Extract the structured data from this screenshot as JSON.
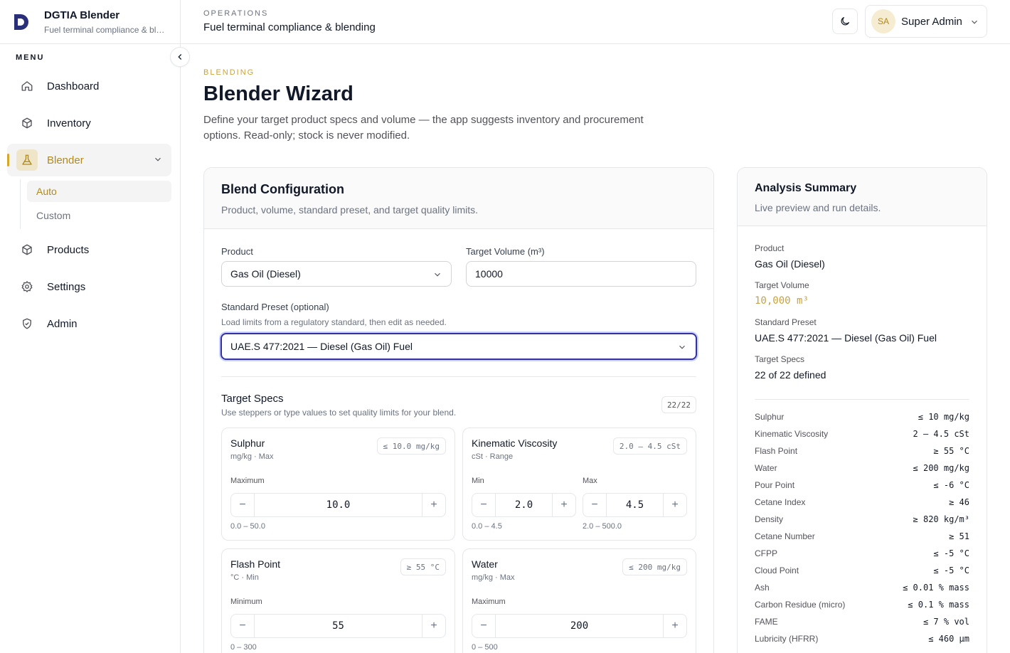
{
  "brand": {
    "title": "DGTIA Blender",
    "subtitle": "Fuel terminal compliance & blending"
  },
  "sidebar": {
    "menu_label": "MENU",
    "items": [
      {
        "label": "Dashboard",
        "icon": "home-icon"
      },
      {
        "label": "Inventory",
        "icon": "box-icon"
      },
      {
        "label": "Blender",
        "icon": "flask-icon",
        "active": true,
        "children": [
          {
            "label": "Auto",
            "active": true
          },
          {
            "label": "Custom"
          }
        ]
      },
      {
        "label": "Products",
        "icon": "box-icon"
      },
      {
        "label": "Settings",
        "icon": "gear-icon"
      },
      {
        "label": "Admin",
        "icon": "shield-icon"
      }
    ]
  },
  "header": {
    "eyebrow": "OPERATIONS",
    "title": "Fuel terminal compliance & blending",
    "user": {
      "initials": "SA",
      "name": "Super Admin"
    }
  },
  "page": {
    "section_label": "BLENDING",
    "title": "Blender Wizard",
    "description": "Define your target product specs and volume — the app suggests inventory and procurement options. Read-only; stock is never modified."
  },
  "config": {
    "title": "Blend Configuration",
    "subtitle": "Product, volume, standard preset, and target quality limits.",
    "product_label": "Product",
    "product_value": "Gas Oil (Diesel)",
    "volume_label": "Target Volume (m³)",
    "volume_value": "10000",
    "preset_label": "Standard Preset (optional)",
    "preset_hint": "Load limits from a regulatory standard, then edit as needed.",
    "preset_value": "UAE.S 477:2021 — Diesel (Gas Oil) Fuel",
    "specs_title": "Target Specs",
    "specs_sub": "Use steppers or type values to set quality limits for your blend.",
    "specs_count": "22/22",
    "specs": [
      {
        "name": "Sulphur",
        "meta": "mg/kg · Max",
        "badge": "≤ 10.0 mg/kg",
        "label": "Maximum",
        "value": "10.0",
        "range": "0.0 – 50.0"
      },
      {
        "name": "Kinematic Viscosity",
        "meta": "cSt · Range",
        "badge": "2.0 – 4.5 cSt",
        "min_label": "Min",
        "min_value": "2.0",
        "min_range": "0.0 – 4.5",
        "max_label": "Max",
        "max_value": "4.5",
        "max_range": "2.0 – 500.0"
      },
      {
        "name": "Flash Point",
        "meta": "°C · Min",
        "badge": "≥ 55 °C",
        "label": "Minimum",
        "value": "55",
        "range": "0 – 300"
      },
      {
        "name": "Water",
        "meta": "mg/kg · Max",
        "badge": "≤ 200 mg/kg",
        "label": "Maximum",
        "value": "200",
        "range": "0 – 500"
      }
    ]
  },
  "summary": {
    "title": "Analysis Summary",
    "subtitle": "Live preview and run details.",
    "product_label": "Product",
    "product_value": "Gas Oil (Diesel)",
    "volume_label": "Target Volume",
    "volume_value": "10,000 m³",
    "preset_label": "Standard Preset",
    "preset_value": "UAE.S 477:2021 — Diesel (Gas Oil) Fuel",
    "specs_label": "Target Specs",
    "specs_value": "22 of 22 defined",
    "limits": [
      {
        "name": "Sulphur",
        "value": "≤ 10 mg/kg"
      },
      {
        "name": "Kinematic Viscosity",
        "value": "2 – 4.5 cSt"
      },
      {
        "name": "Flash Point",
        "value": "≥ 55 °C"
      },
      {
        "name": "Water",
        "value": "≤ 200 mg/kg"
      },
      {
        "name": "Pour Point",
        "value": "≤ -6 °C"
      },
      {
        "name": "Cetane Index",
        "value": "≥ 46"
      },
      {
        "name": "Density",
        "value": "≥ 820 kg/m³"
      },
      {
        "name": "Cetane Number",
        "value": "≥ 51"
      },
      {
        "name": "CFPP",
        "value": "≤ -5 °C"
      },
      {
        "name": "Cloud Point",
        "value": "≤ -5 °C"
      },
      {
        "name": "Ash",
        "value": "≤ 0.01 % mass"
      },
      {
        "name": "Carbon Residue (micro)",
        "value": "≤ 0.1 % mass"
      },
      {
        "name": "FAME",
        "value": "≤ 7 % vol"
      },
      {
        "name": "Lubricity (HFRR)",
        "value": "≤ 460 µm"
      }
    ]
  },
  "colors": {
    "accent": "#c9a23a",
    "focus": "#3730a3",
    "border": "#e5e7eb"
  }
}
